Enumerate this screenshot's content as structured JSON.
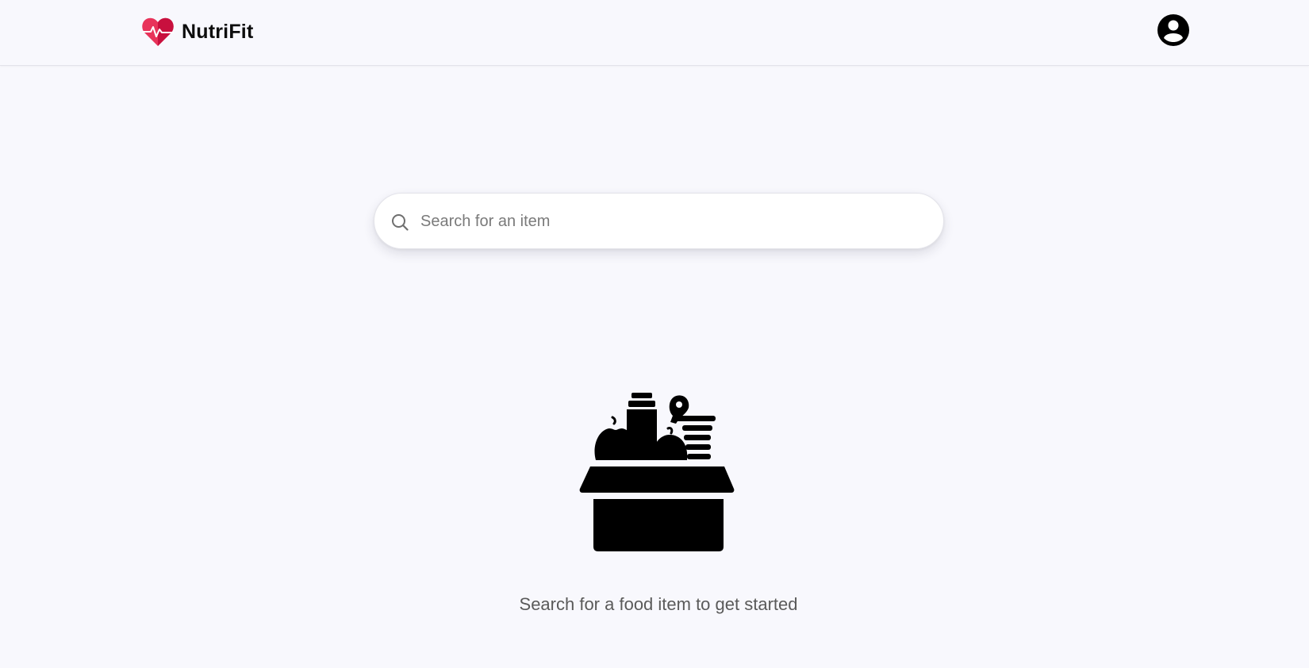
{
  "header": {
    "brand_name": "NutriFit",
    "logo_icon": "heart-pulse-icon",
    "account_icon": "user-circle-icon"
  },
  "search": {
    "placeholder": "Search for an item",
    "value": "",
    "icon": "search-icon"
  },
  "empty_state": {
    "illustration_icon": "grocery-box-icon",
    "message": "Search for a food item to get started"
  },
  "colors": {
    "background": "#f8f8fd",
    "logo_primary": "#e8335a",
    "logo_secondary": "#c8103e",
    "text_primary": "#0d0d0d",
    "text_muted": "#5a5a5a"
  }
}
